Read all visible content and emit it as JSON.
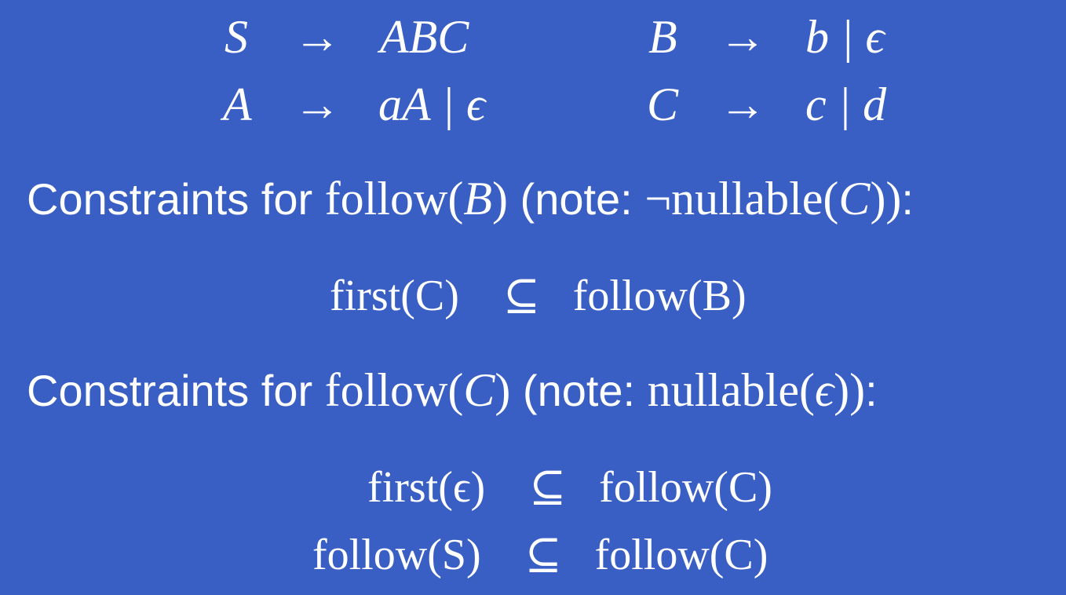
{
  "grammar": {
    "rows": [
      {
        "left": {
          "lhs": "S",
          "arrow": "→",
          "rhs": "ABC"
        },
        "right": {
          "lhs": "B",
          "arrow": "→",
          "rhs": "b | ϵ"
        }
      },
      {
        "left": {
          "lhs": "A",
          "arrow": "→",
          "rhs": "aA | ϵ"
        },
        "right": {
          "lhs": "C",
          "arrow": "→",
          "rhs": "c | d"
        }
      }
    ]
  },
  "section_b": {
    "prefix": "Constraints for ",
    "func": "follow(",
    "var": "B",
    "close": ")",
    "note_open": " (note: ",
    "note_math": "¬nullable(",
    "note_var": "C",
    "note_close": "))",
    "colon": ":",
    "constraint": {
      "left": "first(C)",
      "op": "⊆",
      "right": "follow(B)"
    }
  },
  "section_c": {
    "prefix": "Constraints for ",
    "func": "follow(",
    "var": "C",
    "close": ")",
    "note_open": " (note: ",
    "note_math": "nullable(",
    "note_var": "ϵ",
    "note_close": "))",
    "colon": ":",
    "constraints": [
      {
        "left": "first(ϵ)",
        "op": "⊆",
        "right": "follow(C)"
      },
      {
        "left": "follow(S)",
        "op": "⊆",
        "right": "follow(C)"
      }
    ]
  }
}
